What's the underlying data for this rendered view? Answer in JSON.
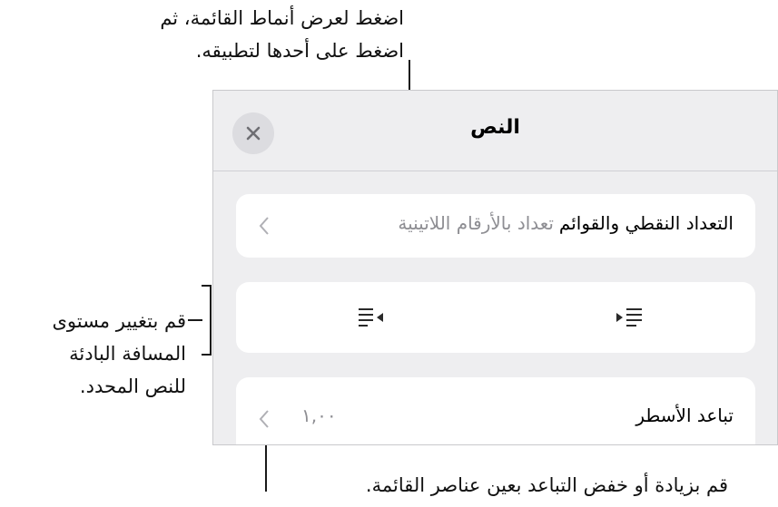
{
  "callouts": {
    "top": [
      "اضغط لعرض أنماط القائمة، ثم",
      "اضغط على أحدها لتطبيقه."
    ],
    "left": [
      "قم بتغيير مستوى",
      "المسافة البادئة",
      "للنص المحدد."
    ],
    "bottom": "قم بزيادة أو خفض التباعد بعين عناصر القائمة."
  },
  "panel": {
    "title": "النص",
    "close_icon": "close-icon",
    "bullets_row": {
      "label": "التعداد النقطي والقوائم",
      "value": "تعداد بالأرقام اللاتينية",
      "icon": "chevron-left-icon"
    },
    "indent_row": {
      "outdent_icon": "decrease-indent-icon",
      "indent_icon": "increase-indent-icon"
    },
    "spacing_row": {
      "label": "تباعد الأسطر",
      "value": "١,٠٠",
      "icon": "chevron-left-icon"
    }
  },
  "colors": {
    "panel_background": "#eeeef0",
    "card_background": "#ffffff",
    "secondary_text": "#8e8e93",
    "callout_line": "#1a1a1a"
  }
}
